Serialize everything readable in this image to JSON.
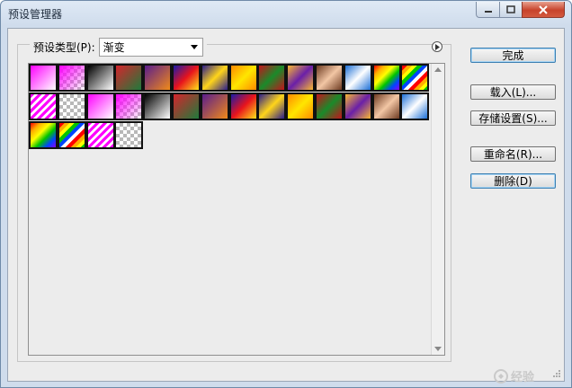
{
  "window": {
    "title": "预设管理器",
    "controls": {
      "minimize": "minimize-icon",
      "maximize": "maximize-icon",
      "close": "close-icon"
    }
  },
  "preset_type": {
    "label": "预设类型(P):",
    "value": "渐变"
  },
  "buttons": {
    "done": "完成",
    "load": "载入(L)...",
    "save": "存储设置(S)...",
    "rename": "重命名(R)...",
    "delete": "删除(D)"
  },
  "watermark": "经验",
  "colors": {
    "window_frame": "#cfdcec",
    "client_bg": "#ececec",
    "close_red": "#c7432b",
    "default_btn_border": "#3c7fb1"
  },
  "swatches": [
    "linear-gradient(135deg,#ff00ff,#ffffff)",
    "linear-gradient(135deg,#ff00ff 0%,rgba(255,0,255,0) 100%),repeating-conic-gradient(#bbb 0 25%,#fff 0 50%) 0 0/8px 8px",
    "linear-gradient(135deg,#000,#fff)",
    "linear-gradient(135deg,#d4252c,#1f7a3b)",
    "linear-gradient(135deg,#5a1d8c,#f08a1a)",
    "linear-gradient(135deg,#1a1aa8,#e8141c 50%,#ffe31a)",
    "linear-gradient(135deg,#2b1d8a,#ffd51a 50%,#2b1d8a)",
    "linear-gradient(135deg,#ff8a00,#ffe600 50%,#ff8a00)",
    "linear-gradient(135deg,#c2141c,#1a8a2a 50%,#c2141c)",
    "linear-gradient(135deg,#f7b733,#6a1fa8 50%,#f7b733)",
    "linear-gradient(135deg,#6e3b22,#f2c6a4 50%,#6e3b22)",
    "linear-gradient(135deg,#1c6fd6,#ffffff 50%,#1c6fd6)",
    "linear-gradient(135deg,#ff0000,#ffae00,#ffff00,#00c400,#0044ff,#8a00ff)",
    "repeating-linear-gradient(135deg,#ff0000 0 4px,#ffae00 4px 8px,#ffff00 8px 12px,#00c400 12px 16px,#0044ff 16px 20px,#ffffff 20px 24px)",
    "repeating-linear-gradient(135deg,#ff00ff 0 3px,#ffffff 3px 6px)",
    "repeating-conic-gradient(#b8b8b8 0 25%,#ffffff 0 50%) 0 0/8px 8px",
    "linear-gradient(135deg,#ff00ff,#ffffff)",
    "linear-gradient(135deg,#ff00ff 0%,rgba(255,0,255,0) 100%),repeating-conic-gradient(#bbb 0 25%,#fff 0 50%) 0 0/8px 8px",
    "linear-gradient(135deg,#000,#fff)",
    "linear-gradient(135deg,#d4252c,#1f7a3b)",
    "linear-gradient(135deg,#5a1d8c,#f08a1a)",
    "linear-gradient(135deg,#1a1aa8,#e8141c 50%,#ffe31a)",
    "linear-gradient(135deg,#2b1d8a,#ffd51a 50%,#2b1d8a)",
    "linear-gradient(135deg,#ff8a00,#ffe600 50%,#ff8a00)",
    "linear-gradient(135deg,#c2141c,#1a8a2a 50%,#c2141c)",
    "linear-gradient(135deg,#f7b733,#6a1fa8 50%,#f7b733)",
    "linear-gradient(135deg,#6e3b22,#f2c6a4 50%,#6e3b22)",
    "linear-gradient(135deg,#1c6fd6,#ffffff 50%,#1c6fd6)",
    "linear-gradient(135deg,#ff0000,#ffae00,#ffff00,#00c400,#0044ff,#8a00ff)",
    "repeating-linear-gradient(135deg,#ff0000 0 4px,#ffae00 4px 8px,#ffff00 8px 12px,#00c400 12px 16px,#0044ff 16px 20px,#ffffff 20px 24px)",
    "repeating-linear-gradient(135deg,#ff00ff 0 3px,#ffffff 3px 6px)",
    "repeating-conic-gradient(#b8b8b8 0 25%,#ffffff 0 50%) 0 0/8px 8px"
  ]
}
